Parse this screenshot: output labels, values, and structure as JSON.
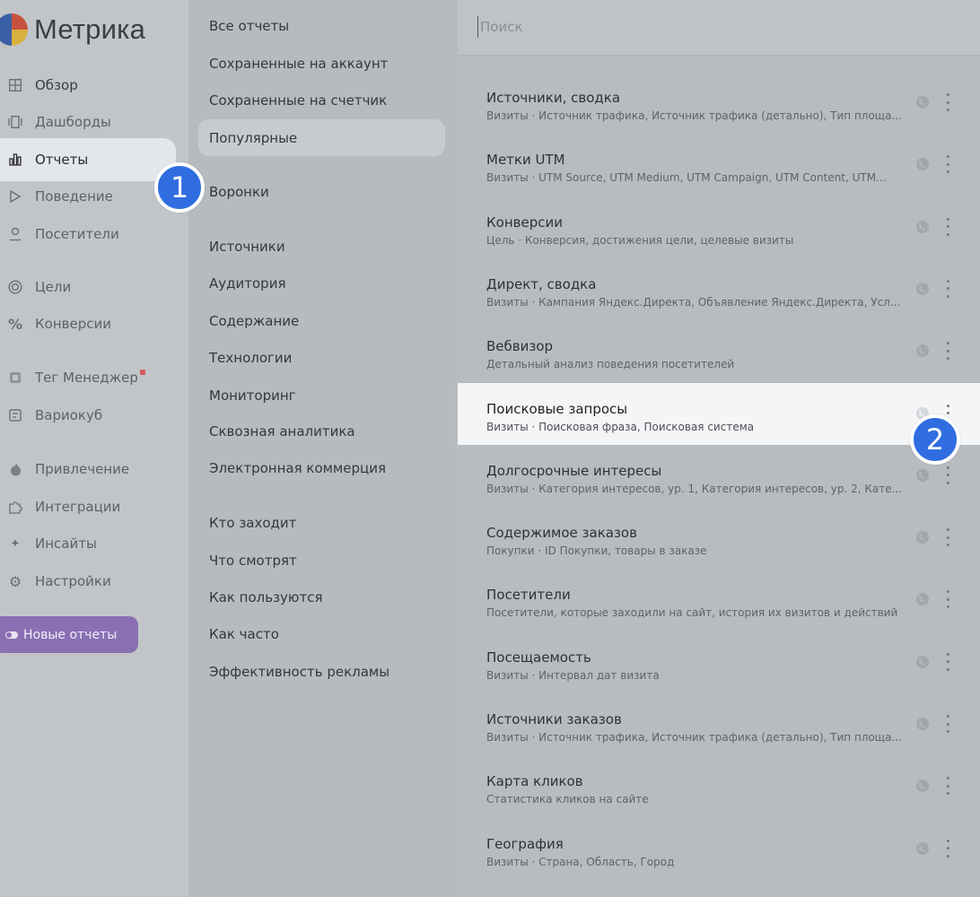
{
  "app": {
    "logo_text": "Метрика"
  },
  "sidebar": {
    "items": [
      {
        "label": "Обзор",
        "icon": "grid-icon"
      },
      {
        "label": "Дашборды",
        "icon": "dashboard-icon"
      },
      {
        "label": "Отчеты",
        "icon": "reports-icon",
        "active": true
      },
      {
        "label": "Поведение",
        "icon": "play-icon"
      },
      {
        "label": "Посетители",
        "icon": "user-icon"
      },
      {
        "label": "Цели",
        "icon": "target-icon"
      },
      {
        "label": "Конверсии",
        "icon": "percent-icon"
      },
      {
        "label": "Тег Менеджер",
        "icon": "tag-manager-icon"
      },
      {
        "label": "Вариокуб",
        "icon": "variocube-icon"
      },
      {
        "label": "Привлечение",
        "icon": "flame-icon"
      },
      {
        "label": "Интеграции",
        "icon": "puzzle-icon"
      },
      {
        "label": "Инсайты",
        "icon": "sparkle-icon"
      },
      {
        "label": "Настройки",
        "icon": "gear-icon"
      }
    ],
    "new_reports_button": "Новые отчеты"
  },
  "menu": {
    "items": [
      "Все отчеты",
      "Сохраненные на аккаунт",
      "Сохраненные на счетчик",
      "Популярные",
      "Воронки",
      "Источники",
      "Аудитория",
      "Содержание",
      "Технологии",
      "Мониторинг",
      "Сквозная аналитика",
      "Электронная коммерция",
      "Кто заходит",
      "Что смотрят",
      "Как пользуются",
      "Как часто",
      "Эффективность рекламы"
    ],
    "selected": "Популярные"
  },
  "search": {
    "placeholder": "Поиск"
  },
  "reports": [
    {
      "title": "Источники, сводка",
      "subtitle": "Визиты · Источник трафика, Источник трафика (детально), Тип площа..."
    },
    {
      "title": "Метки UTM",
      "subtitle": "Визиты · UTM Source, UTM Medium, UTM Campaign, UTM Content, UTM..."
    },
    {
      "title": "Конверсии",
      "subtitle": "Цель · Конверсия, достижения цели, целевые визиты"
    },
    {
      "title": "Директ, сводка",
      "subtitle": "Визиты · Кампания Яндекс.Директа, Объявление Яндекс.Директа, Усл..."
    },
    {
      "title": "Вебвизор",
      "subtitle": "Детальный анализ поведения посетителей"
    },
    {
      "title": "Поисковые запросы",
      "subtitle": "Визиты · Поисковая фраза, Поисковая система",
      "highlighted": true
    },
    {
      "title": "Долгосрочные интересы",
      "subtitle": "Визиты · Категория интересов, ур. 1, Категория интересов, ур. 2, Кате..."
    },
    {
      "title": "Содержимое заказов",
      "subtitle": "Покупки · ID Покупки, товары в заказе"
    },
    {
      "title": "Посетители",
      "subtitle": "Посетители, которые заходили на сайт, история их визитов и действий"
    },
    {
      "title": "Посещаемость",
      "subtitle": "Визиты · Интервал дат визита"
    },
    {
      "title": "Источники заказов",
      "subtitle": "Визиты · Источник трафика, Источник трафика (детально), Тип площа..."
    },
    {
      "title": "Карта кликов",
      "subtitle": "Статистика кликов на сайте"
    },
    {
      "title": "География",
      "subtitle": "Визиты · Страна, Область, Город"
    }
  ],
  "markers": [
    "1",
    "2"
  ],
  "colors": {
    "marker": "#2f6de1",
    "new_reports_button": "#8a70b3",
    "highlight_row": "#f4f5f7"
  }
}
